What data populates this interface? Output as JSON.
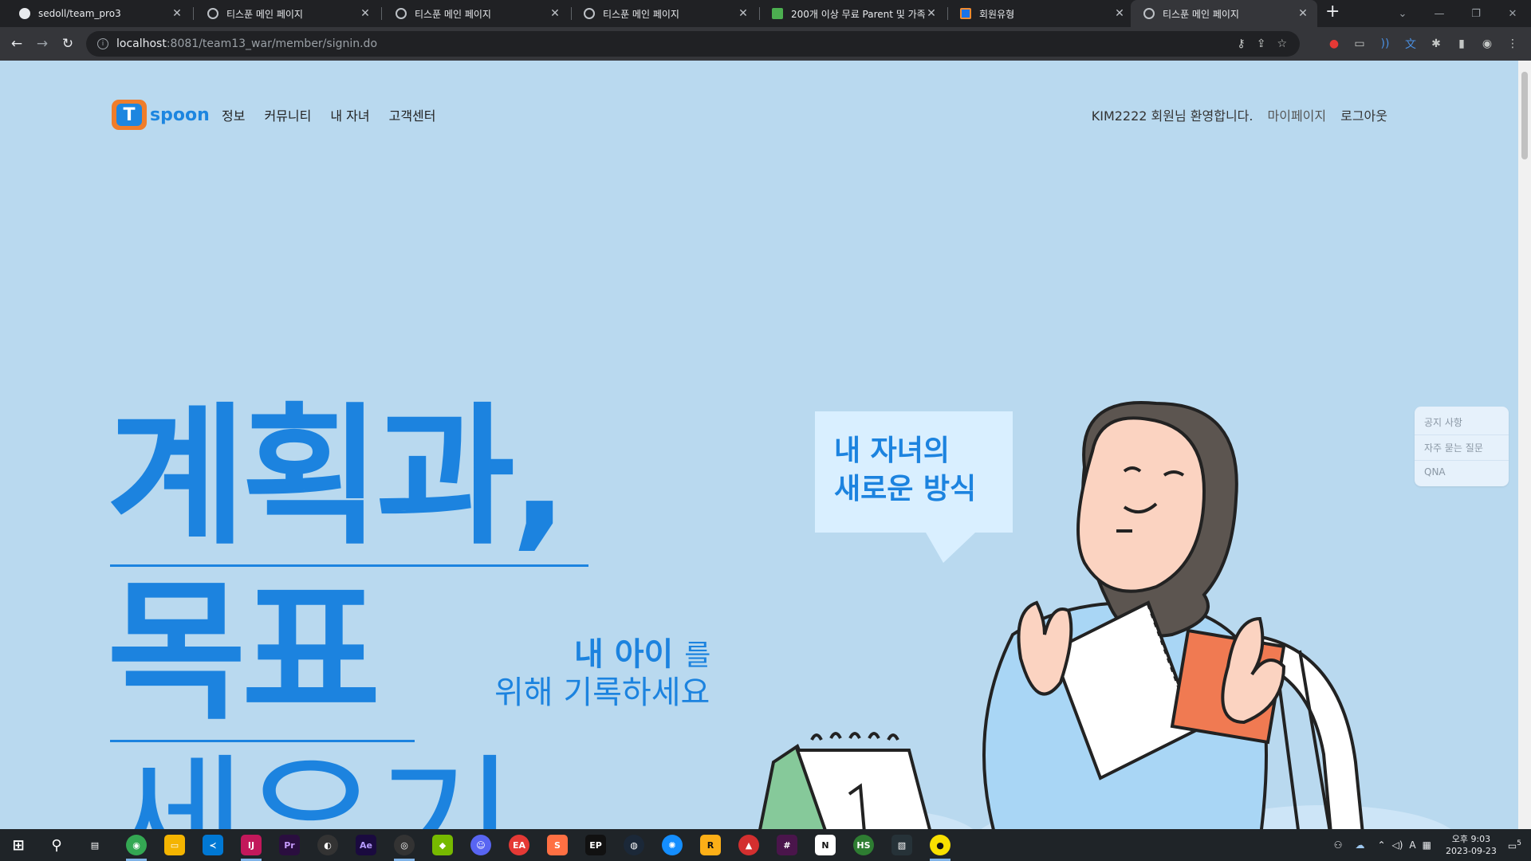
{
  "browser": {
    "tabs": [
      {
        "title": "sedoll/team_pro3",
        "favicon": "github-icon",
        "active": false
      },
      {
        "title": "티스푼 메인 페이지",
        "favicon": "globe-icon",
        "active": false
      },
      {
        "title": "티스푼 메인 페이지",
        "favicon": "globe-icon",
        "active": false
      },
      {
        "title": "티스푼 메인 페이지",
        "favicon": "globe-icon",
        "active": false
      },
      {
        "title": "200개 이상 무료 Parent 및 가족",
        "favicon": "px-icon",
        "active": false
      },
      {
        "title": "회원유형",
        "favicon": "tspoon-icon",
        "active": false
      },
      {
        "title": "티스푼 메인 페이지",
        "favicon": "globe-icon",
        "active": true
      }
    ],
    "new_tab": "+",
    "address": {
      "host": "localhost",
      "path": ":8081/team13_war/member/signin.do"
    }
  },
  "site": {
    "logo": {
      "letter": "T",
      "word": "spoon"
    },
    "nav": [
      "정보",
      "커뮤니티",
      "내 자녀",
      "고객센터"
    ],
    "user": {
      "greeting": "KIM2222 회원님 환영합니다.",
      "mypage": "마이페이지",
      "logout": "로그아웃"
    },
    "hero": {
      "line1": "계획과,",
      "line2": "목표",
      "line3": "세우기",
      "sub_bold": "내 아이",
      "sub_rest": "를",
      "sub_line2": "위해 기록하세요"
    },
    "bubble": {
      "line1": "내 자녀의",
      "line2": "새로운 방식"
    },
    "calendar_number": "1",
    "floating_menu": [
      "공지 사항",
      "자주 묻는 질문",
      "QNA"
    ]
  },
  "taskbar": {
    "clock_line1": "오후 9:03",
    "clock_line2": "2023-09-23",
    "ime": "A",
    "notification_count": "5",
    "apps": [
      "windows-start-icon",
      "search-icon",
      "task-view-icon",
      "chrome-icon",
      "file-explorer-icon",
      "vscode-icon",
      "intellij-icon",
      "premiere-icon",
      "davinci-icon",
      "after-effects-icon",
      "obs-icon",
      "nvidia-icon",
      "discord-icon",
      "ea-icon",
      "s-app-icon",
      "epic-games-icon",
      "steam-icon",
      "battlenet-icon",
      "rockstar-icon",
      "red-app-icon",
      "slack-icon",
      "notion-icon",
      "hs-app-icon",
      "editor-icon",
      "kakao-icon"
    ]
  },
  "colors": {
    "page_bg": "#b9d9ef",
    "brand_blue": "#1c83df",
    "brand_orange": "#f07d2a"
  }
}
